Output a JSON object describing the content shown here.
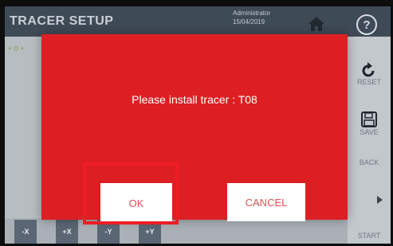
{
  "header": {
    "title": "TRACER SETUP",
    "user": "Administrator",
    "date": "15/04/2019",
    "help_label": "?"
  },
  "background": {
    "info_text": "+ 0  +"
  },
  "sidebar": {
    "reset_label": "RESET",
    "save_label": "SAVE",
    "back_label": "BACK",
    "start_label": "START"
  },
  "bottom_buttons": [
    "-X",
    "+X",
    "-Y",
    "+Y"
  ],
  "dialog": {
    "message": "Please install tracer : T08",
    "ok_label": "OK",
    "cancel_label": "CANCEL"
  },
  "colors": {
    "dialog_background": "#dd1f23",
    "highlight_border": "#ef1d24",
    "button_text": "#e35155"
  }
}
